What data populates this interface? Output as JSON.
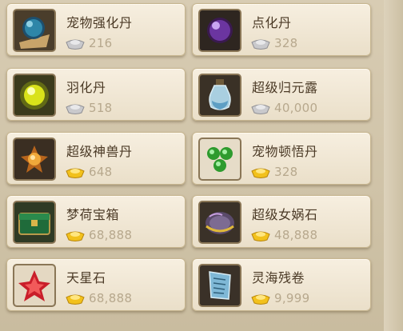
{
  "items": [
    {
      "name": "宠物强化丹",
      "price": "216",
      "currency": "silver",
      "icon": "blue-orb-icon"
    },
    {
      "name": "点化丹",
      "price": "328",
      "currency": "silver",
      "icon": "purple-orb-icon"
    },
    {
      "name": "羽化丹",
      "price": "518",
      "currency": "silver",
      "icon": "yellow-orb-icon"
    },
    {
      "name": "超级归元露",
      "price": "40,000",
      "currency": "silver",
      "icon": "potion-bottle-icon"
    },
    {
      "name": "超级神兽丹",
      "price": "648",
      "currency": "gold",
      "icon": "beast-pill-icon"
    },
    {
      "name": "宠物顿悟丹",
      "price": "328",
      "currency": "gold",
      "icon": "green-pills-icon"
    },
    {
      "name": "梦荷宝箱",
      "price": "68,888",
      "currency": "gold",
      "icon": "jade-chest-icon"
    },
    {
      "name": "超级女娲石",
      "price": "48,888",
      "currency": "gold",
      "icon": "nuwa-stone-icon"
    },
    {
      "name": "天星石",
      "price": "68,888",
      "currency": "gold",
      "icon": "star-crystal-icon"
    },
    {
      "name": "灵海残卷",
      "price": "9,999",
      "currency": "gold",
      "icon": "scroll-fragment-icon"
    }
  ],
  "colors": {
    "silver": "#c9c9cc",
    "gold": "#f2c11c"
  }
}
